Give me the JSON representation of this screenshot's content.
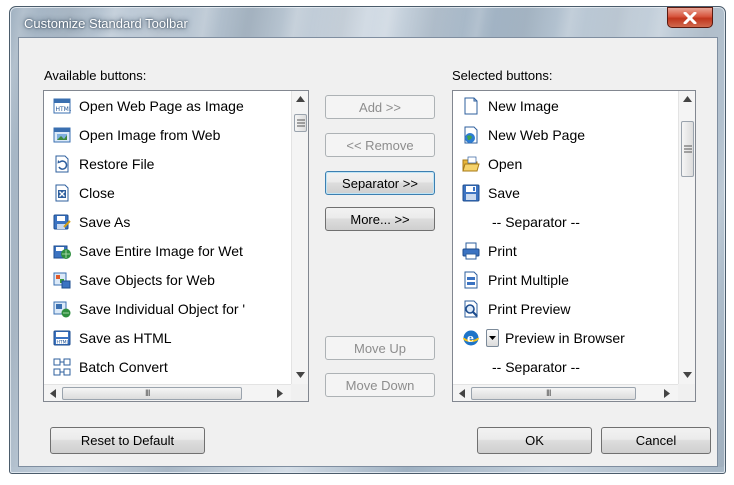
{
  "window": {
    "title": "Customize Standard Toolbar"
  },
  "available": {
    "label": "Available buttons:",
    "items": [
      {
        "label": "Open Web Page as Image",
        "icon": "html-page-icon"
      },
      {
        "label": "Open Image from Web",
        "icon": "web-image-icon"
      },
      {
        "label": "Restore File",
        "icon": "restore-file-icon"
      },
      {
        "label": "Close",
        "icon": "close-file-icon"
      },
      {
        "label": "Save As",
        "icon": "save-as-icon"
      },
      {
        "label": "Save Entire Image for Wet",
        "icon": "save-for-web-icon"
      },
      {
        "label": "Save Objects for Web",
        "icon": "save-objects-icon"
      },
      {
        "label": "Save Individual Object for '",
        "icon": "save-object-icon"
      },
      {
        "label": "Save as HTML",
        "icon": "save-html-icon"
      },
      {
        "label": "Batch Convert",
        "icon": "batch-convert-icon"
      }
    ]
  },
  "selected": {
    "label": "Selected buttons:",
    "items": [
      {
        "label": "New Image",
        "icon": "new-image-icon"
      },
      {
        "label": "New Web Page",
        "icon": "new-web-page-icon"
      },
      {
        "label": "Open",
        "icon": "folder-open-icon"
      },
      {
        "label": "Save",
        "icon": "floppy-disk-icon"
      },
      {
        "label": "-- Separator --",
        "icon": ""
      },
      {
        "label": "Print",
        "icon": "printer-icon"
      },
      {
        "label": "Print Multiple",
        "icon": "print-multiple-icon"
      },
      {
        "label": "Print Preview",
        "icon": "print-preview-icon"
      },
      {
        "label": "Preview in Browser",
        "icon": "browser-preview-icon"
      },
      {
        "label": "-- Separator --",
        "icon": ""
      }
    ]
  },
  "buttons": {
    "add": "Add >>",
    "remove": "<< Remove",
    "separator": "Separator >>",
    "more": "More... >>",
    "move_up": "Move Up",
    "move_down": "Move Down",
    "reset": "Reset to Default",
    "ok": "OK",
    "cancel": "Cancel"
  },
  "scroll_glyph": "III",
  "colors": {
    "close_button": "#c7402a",
    "dialog_bg": "#f0f0f0"
  }
}
